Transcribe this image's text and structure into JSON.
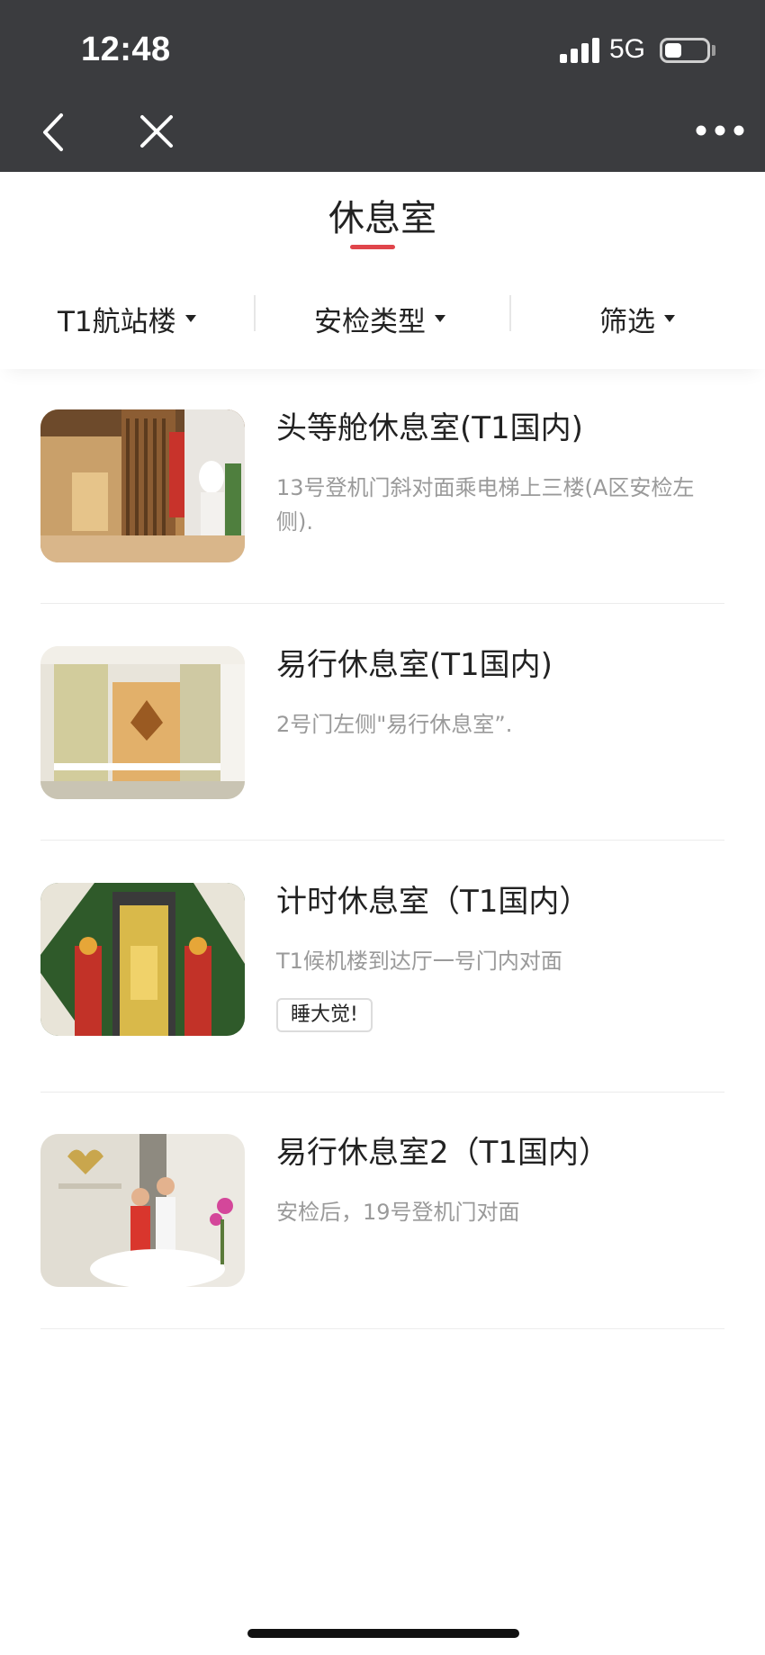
{
  "status_bar": {
    "time": "12:48",
    "network": "5G",
    "battery_level": 0.4
  },
  "nav": {
    "back_icon": "chevron-left-icon",
    "close_icon": "close-icon",
    "more_icon": "more-icon"
  },
  "page": {
    "title": "休息室",
    "accent_color": "#e0454b"
  },
  "filters": [
    {
      "label": "T1航站楼"
    },
    {
      "label": "安检类型"
    },
    {
      "label": "筛选"
    }
  ],
  "lounges": [
    {
      "name": "头等舱休息室(T1国内)",
      "location": "13号登机门斜对面乘电梯上三楼(A区安检左侧).",
      "tag": ""
    },
    {
      "name": "易行休息室(T1国内)",
      "location": "2号门左侧\"易行休息室”.",
      "tag": ""
    },
    {
      "name": "计时休息室（T1国内）",
      "location": "T1候机楼到达厅一号门内对面",
      "tag": "睡大觉!"
    },
    {
      "name": "易行休息室2（T1国内）",
      "location": "安检后，19号登机门对面",
      "tag": ""
    }
  ]
}
